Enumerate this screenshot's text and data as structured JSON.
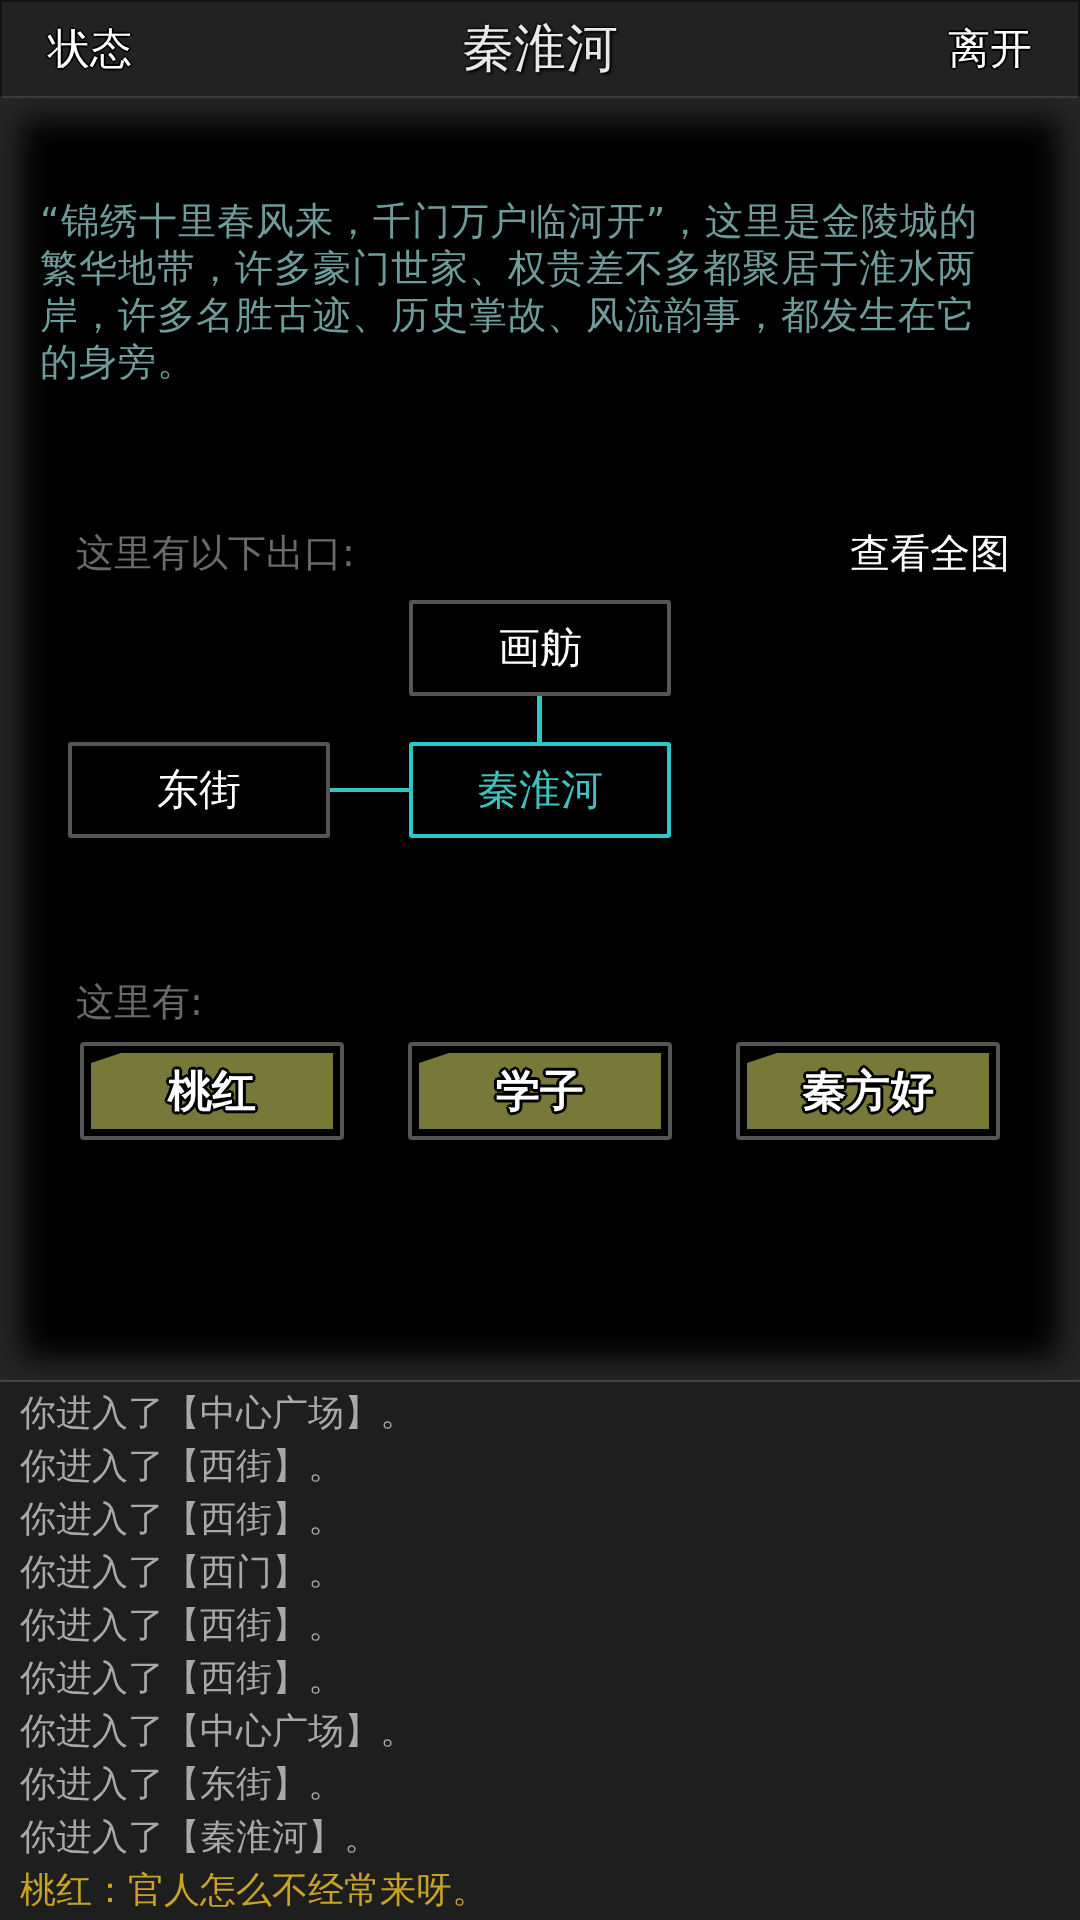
{
  "header": {
    "left_button": "状态",
    "title": "秦淮河",
    "right_button": "离开"
  },
  "description": "“锦绣十里春风来，千门万户临河开”，这里是金陵城的繁华地带，许多豪门世家、权贵差不多都聚居于淮水两岸，许多名胜古迹、历史掌故、风流韵事，都发生在它的身旁。",
  "exits": {
    "label": "这里有以下出口:",
    "map_link": "查看全图",
    "nodes": [
      {
        "name": "画舫",
        "kind": "north",
        "selected": false
      },
      {
        "name": "东街",
        "kind": "west",
        "selected": false
      },
      {
        "name": "秦淮河",
        "kind": "center",
        "selected": true
      }
    ]
  },
  "npcs": {
    "label": "这里有:",
    "items": [
      "桃红",
      "学子",
      "秦方好"
    ]
  },
  "log": [
    {
      "kind": "system",
      "text": "你进入了【中心广场】。"
    },
    {
      "kind": "system",
      "text": "你进入了【西街】。"
    },
    {
      "kind": "system",
      "text": "你进入了【西街】。"
    },
    {
      "kind": "system",
      "text": "你进入了【西门】。"
    },
    {
      "kind": "system",
      "text": "你进入了【西街】。"
    },
    {
      "kind": "system",
      "text": "你进入了【西街】。"
    },
    {
      "kind": "system",
      "text": "你进入了【中心广场】。"
    },
    {
      "kind": "system",
      "text": "你进入了【东街】。"
    },
    {
      "kind": "system",
      "text": "你进入了【秦淮河】。"
    },
    {
      "kind": "speech",
      "text": "桃红：官人怎么不经常来呀。"
    }
  ]
}
